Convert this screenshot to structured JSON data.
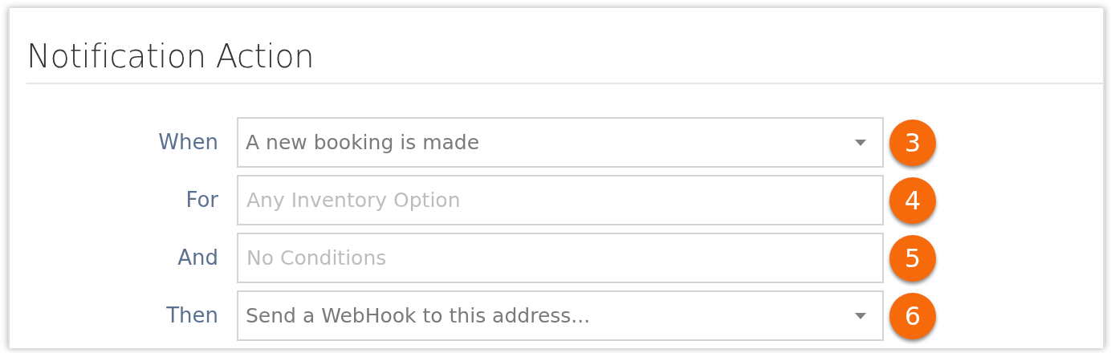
{
  "title": "Notification Action",
  "rows": [
    {
      "label": "When",
      "kind": "select",
      "value": "A new booking is made",
      "badge": "3"
    },
    {
      "label": "For",
      "kind": "text",
      "placeholder": "Any Inventory Option",
      "badge": "4"
    },
    {
      "label": "And",
      "kind": "text",
      "placeholder": "No Conditions",
      "badge": "5"
    },
    {
      "label": "Then",
      "kind": "select",
      "value": "Send a WebHook to this address...",
      "badge": "6"
    }
  ]
}
